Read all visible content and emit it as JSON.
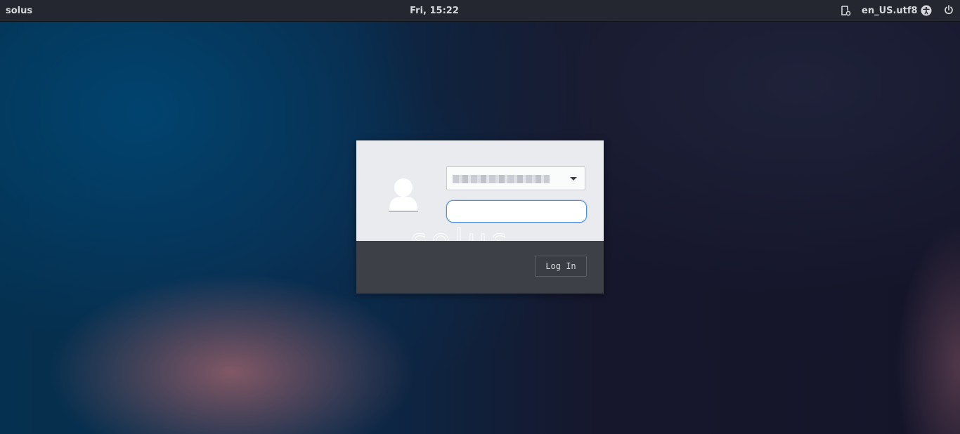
{
  "topbar": {
    "brand": "solus",
    "clock": "Fri, 15:22",
    "locale": "en_US.utf8",
    "icons": {
      "keyboard_layout": "layout-icon",
      "accessibility": "accessibility-icon",
      "power": "power-icon"
    }
  },
  "login": {
    "watermark": "solus",
    "avatar_icon": "user-avatar-icon",
    "user_select": {
      "value": "",
      "icon": "chevron-down-icon"
    },
    "password": {
      "value": "",
      "placeholder": ""
    },
    "login_label": "Log In"
  },
  "colors": {
    "topbar": "#242730",
    "card_top": "#e9ebee",
    "card_bottom": "#3d4047",
    "focus_accent": "#4a90d9"
  }
}
